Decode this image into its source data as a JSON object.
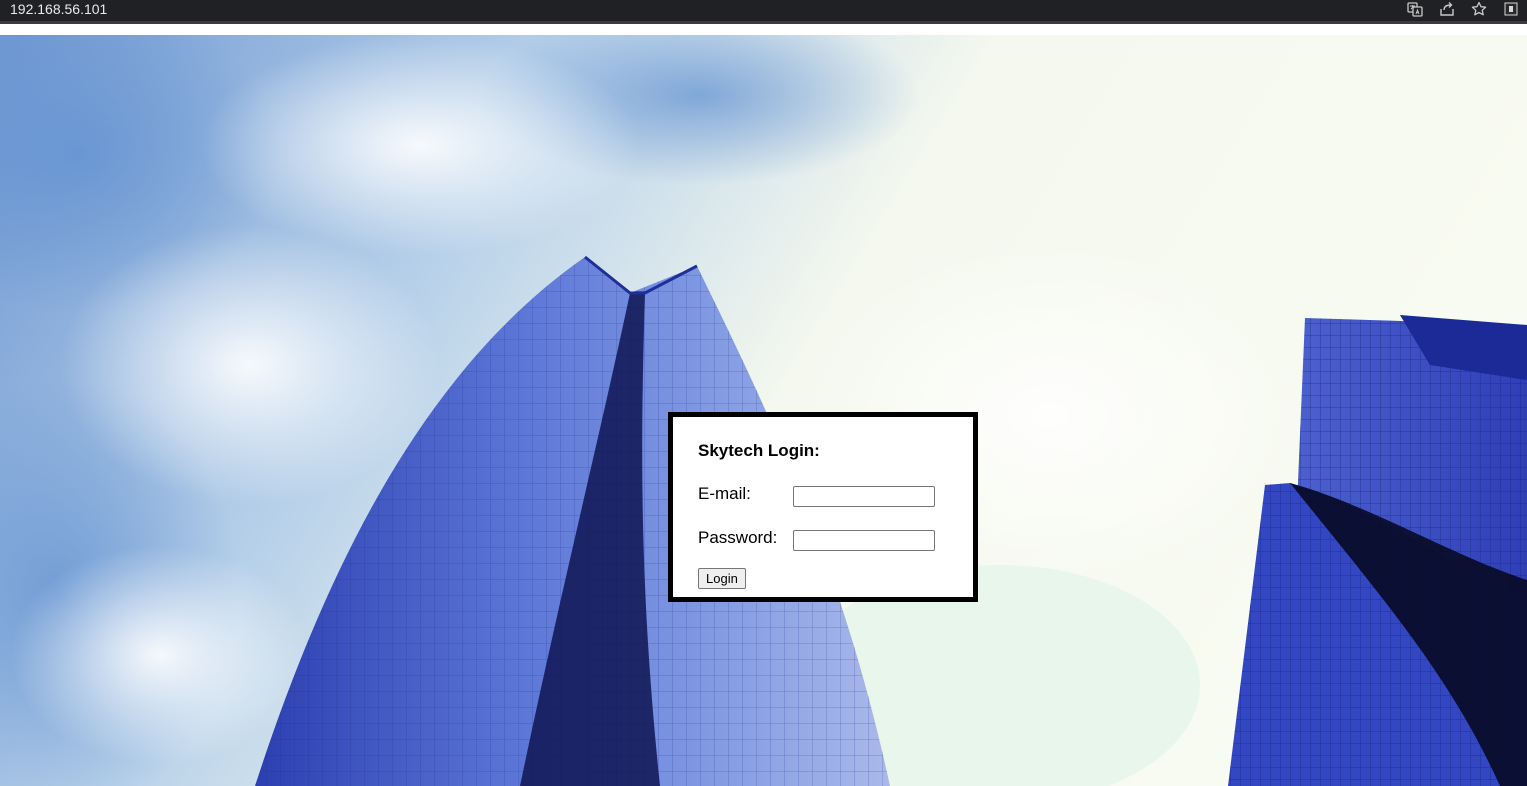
{
  "browser": {
    "url": "192.168.56.101",
    "icons": [
      "translate-icon",
      "share-icon",
      "bookmark-star-icon",
      "extension-icon"
    ]
  },
  "login": {
    "title": "Skytech Login:",
    "email_label": "E-mail:",
    "email_value": "",
    "password_label": "Password:",
    "password_value": "",
    "button_label": "Login"
  },
  "colors": {
    "browser_bar": "#202124",
    "sky_blue": "#7fa6d8",
    "building_blue": "#3a4fc0",
    "box_border": "#000000"
  }
}
